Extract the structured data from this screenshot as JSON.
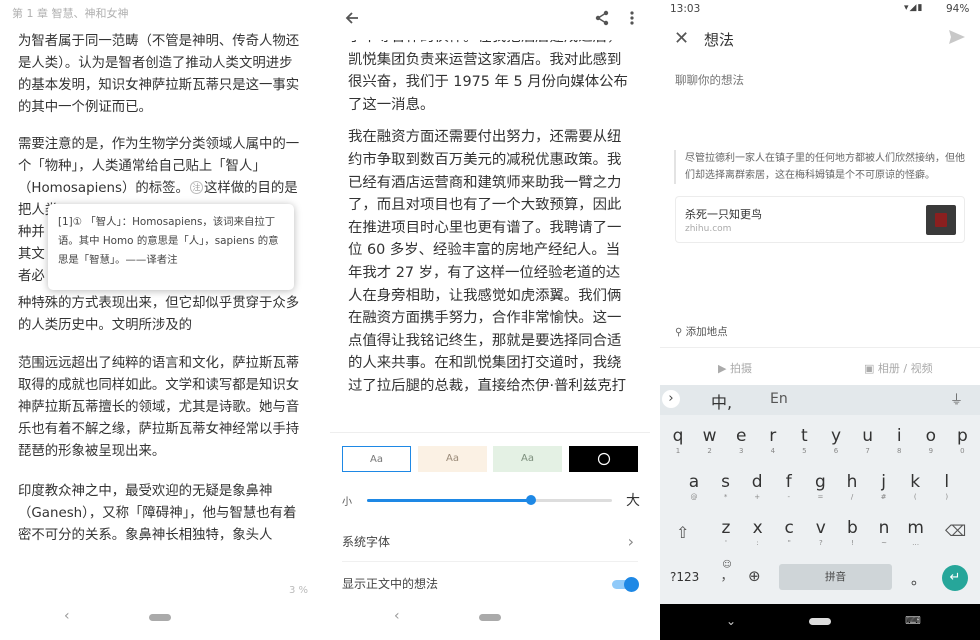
{
  "panel1": {
    "chapter_title": "第 1 章 智慧、神和女神",
    "paragraphs": [
      "为智者属于同一范畴（不管是神明、传奇人物还是人类）。认为是智者创造了推动人类文明进步的基本发明，知识女神萨拉斯瓦蒂只是这一事实的其中一个例证而已。",
      "需要注意的是，作为生物学分类领域人属中的一个「物种」，人类通常给自己贴上「智人」（Homosapiens）的标签。",
      "这样做的目的是把人类",
      "种特殊的方式表现出来，但它却似乎贯穿于众多的人类历史中。文明所涉及的",
      "范围远远超出了纯粹的语言和文化，萨拉斯瓦蒂取得的成就也同样如此。文学和读写都是知识女神萨拉斯瓦蒂擅长的领域，尤其是诗歌。她与音乐也有着不解之缘，萨拉斯瓦蒂女神经常以手持琵琶的形象被呈现出来。",
      "印度教众神之中，最受欢迎的无疑是象鼻神（Ganesh），又称「障碍神」，他与智慧也有着密不可分的关系。象鼻神长相独特，象头人"
    ],
    "partial_lines": [
      "种并",
      "其文",
      "者必"
    ],
    "note_marker": "注",
    "footnote_text": "[1]① 「智人」：Homosapiens，该词来自拉丁语。其中 Homo 的意思是「人」，sapiens 的意思是「智慧」。——译者注",
    "progress_percent": "3 %"
  },
  "panel2": {
    "paragraphs": [
      "了中等合作的伙伴。在我把酒店建成之后，凯悦集团负责来运营这家酒店。我对此感到很兴奋，我们于 1975 年 5 月份向媒体公布了这一消息。",
      "我在融资方面还需要付出努力，还需要从纽约市争取到数百万美元的减税优惠政策。我已经有酒店运营商和建筑师来助我一臂之力了，而且对项目也有了一个大致预算，因此在推进项目时心里也更有谱了。我聘请了一位 60 多岁、经验丰富的房地产经纪人。当年我才 27 岁，有了这样一位经验老道的达人在身旁相助，让我感觉如虎添翼。我们俩在融资方面携手努力，合作非常愉快。这一点值得让我铭记终生，那就是要选择同合适的人来共事。在和凯悦集团打交道时，我绕过了拉后腿的总裁，直接给杰伊·普利兹克打"
    ],
    "themes": [
      {
        "label": "Aa",
        "bg": "#ffffff",
        "fg": "#777777",
        "selected": true
      },
      {
        "label": "Aa",
        "bg": "#fbf1e4",
        "fg": "#9a8a78",
        "selected": false
      },
      {
        "label": "Aa",
        "bg": "#e4f1e4",
        "fg": "#7d8f7d",
        "selected": false
      },
      {
        "label": "moon-icon",
        "bg": "#000000",
        "fg": "#ffffff",
        "selected": false
      }
    ],
    "font_size": {
      "small_label": "小",
      "large_label": "大",
      "level": 0.67
    },
    "system_font_label": "系统字体",
    "show_thoughts_label": "显示正文中的想法",
    "show_thoughts_on": true,
    "accent": "#1e88e5"
  },
  "panel3": {
    "status_time": "13:03",
    "battery": "94%",
    "title": "想法",
    "placeholder": "聊聊你的想法",
    "quote": "尽管拉德利一家人在镇子里的任何地方都被人们欣然接纳，但他们却选择离群索居，这在梅科姆镇是个不可原谅的怪癖。",
    "link_title": "杀死一只知更鸟",
    "link_domain": "zhihu.com",
    "add_location": "添加地点",
    "media": {
      "shoot": "拍摄",
      "album": "相册 / 视频"
    },
    "keyboard": {
      "mode_cn": "中,",
      "mode_en": "En",
      "row1": [
        [
          "q",
          "1"
        ],
        [
          "w",
          "2"
        ],
        [
          "e",
          "3"
        ],
        [
          "r",
          "4"
        ],
        [
          "t",
          "5"
        ],
        [
          "y",
          "6"
        ],
        [
          "u",
          "7"
        ],
        [
          "i",
          "8"
        ],
        [
          "o",
          "9"
        ],
        [
          "p",
          "0"
        ]
      ],
      "row2": [
        [
          "a",
          "@"
        ],
        [
          "s",
          "*"
        ],
        [
          "d",
          "+"
        ],
        [
          "f",
          "-"
        ],
        [
          "g",
          "="
        ],
        [
          "h",
          "/"
        ],
        [
          "j",
          "#"
        ],
        [
          "k",
          "("
        ],
        [
          "l",
          ")"
        ]
      ],
      "row3": [
        [
          "z",
          "'"
        ],
        [
          "x",
          ":"
        ],
        [
          "c",
          "\""
        ],
        [
          "v",
          "?"
        ],
        [
          "b",
          "!"
        ],
        [
          "n",
          "~"
        ],
        [
          "m",
          "…"
        ]
      ],
      "numbers_key": "?123",
      "space_label": "拼音",
      "period_key": "。",
      "comma_key": "，",
      "comma_sub": "☺"
    }
  }
}
